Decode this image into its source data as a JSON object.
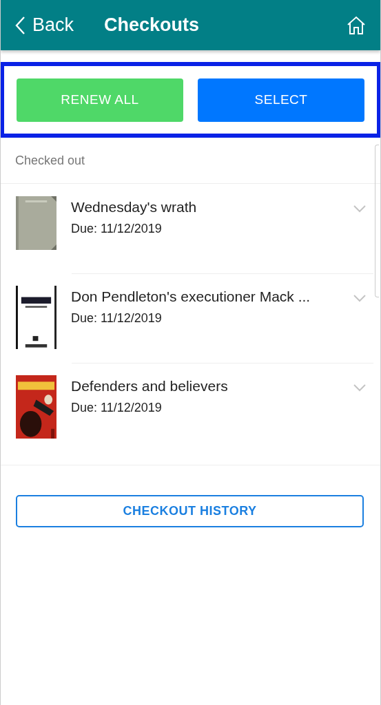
{
  "header": {
    "back_label": "Back",
    "title": "Checkouts"
  },
  "actions": [
    {
      "label": "RENEW ALL",
      "kind": "renew"
    },
    {
      "label": "SELECT",
      "kind": "select"
    }
  ],
  "section_title": "Checked out",
  "items": [
    {
      "title": "Wednesday's wrath",
      "due": "Due: 11/12/2019"
    },
    {
      "title": "Don Pendleton's executioner Mack ...",
      "due": "Due: 11/12/2019"
    },
    {
      "title": "Defenders and believers",
      "due": "Due: 11/12/2019"
    }
  ],
  "history_button": "CHECKOUT HISTORY"
}
